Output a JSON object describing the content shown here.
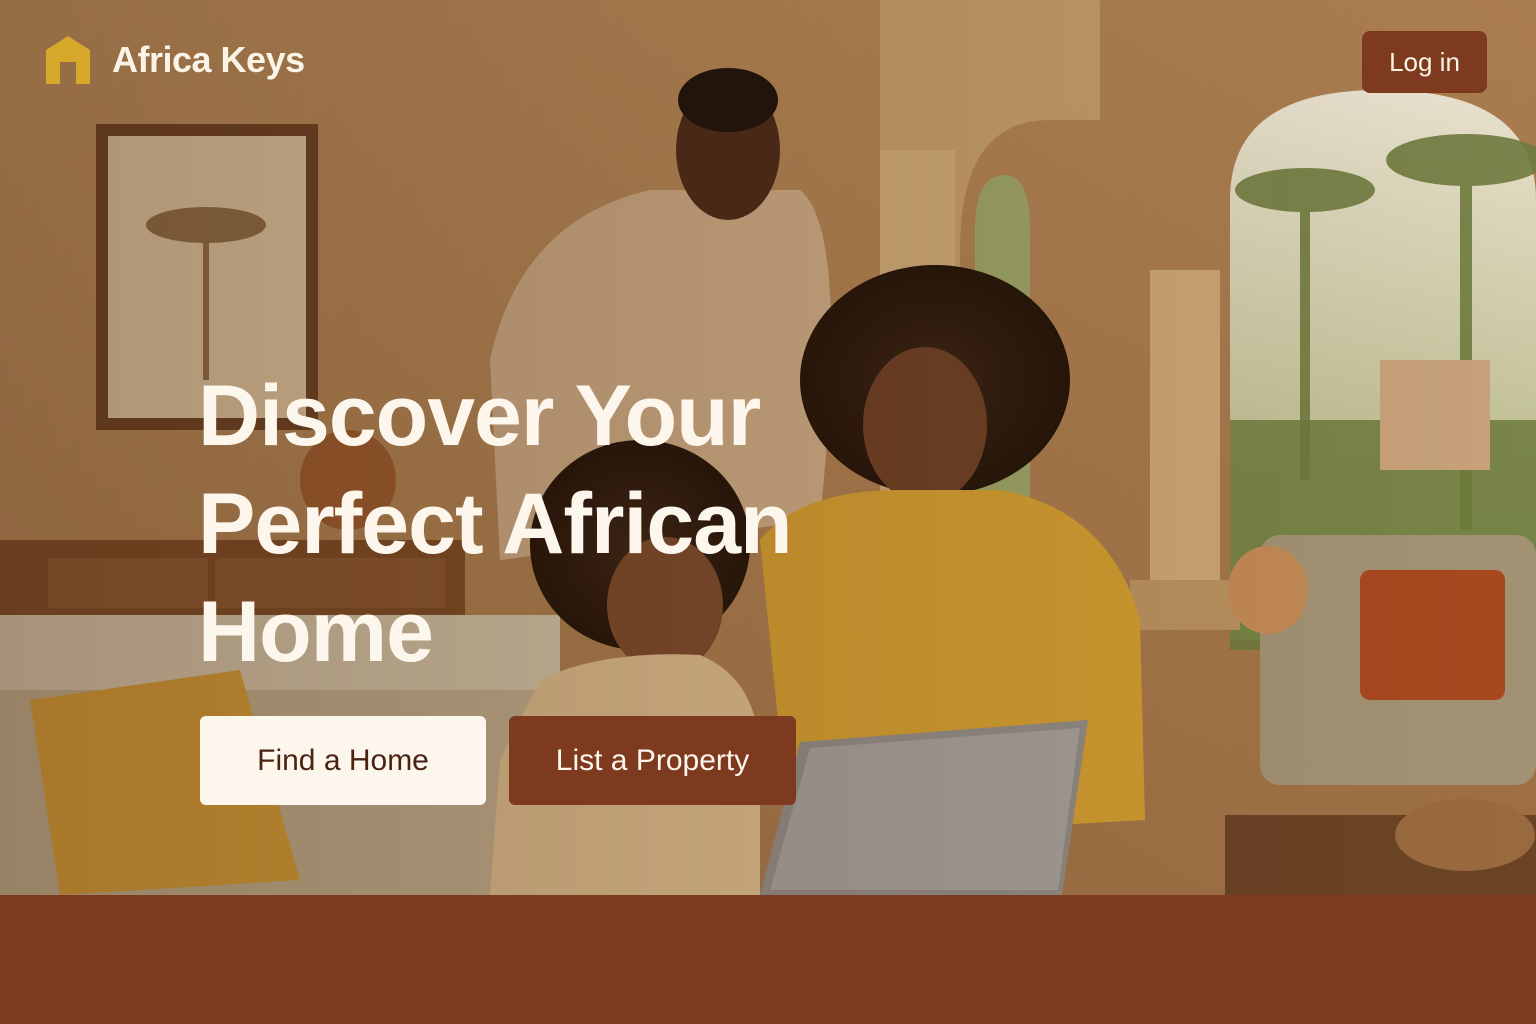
{
  "header": {
    "brand_name": "Africa Keys",
    "brand_icon": "house-icon",
    "login_label": "Log in"
  },
  "hero": {
    "headline": "Discover Your Perfect African Home",
    "photo": "family-browsing-laptop-photo",
    "buttons": {
      "find_home_label": "Find a Home",
      "list_property_label": "List a Property"
    }
  },
  "colors": {
    "brand_accent": "#7d3a1f",
    "logo_gold": "#d6a92a",
    "light_button": "#fcf6ec",
    "headline_text": "#fcf6ec"
  }
}
